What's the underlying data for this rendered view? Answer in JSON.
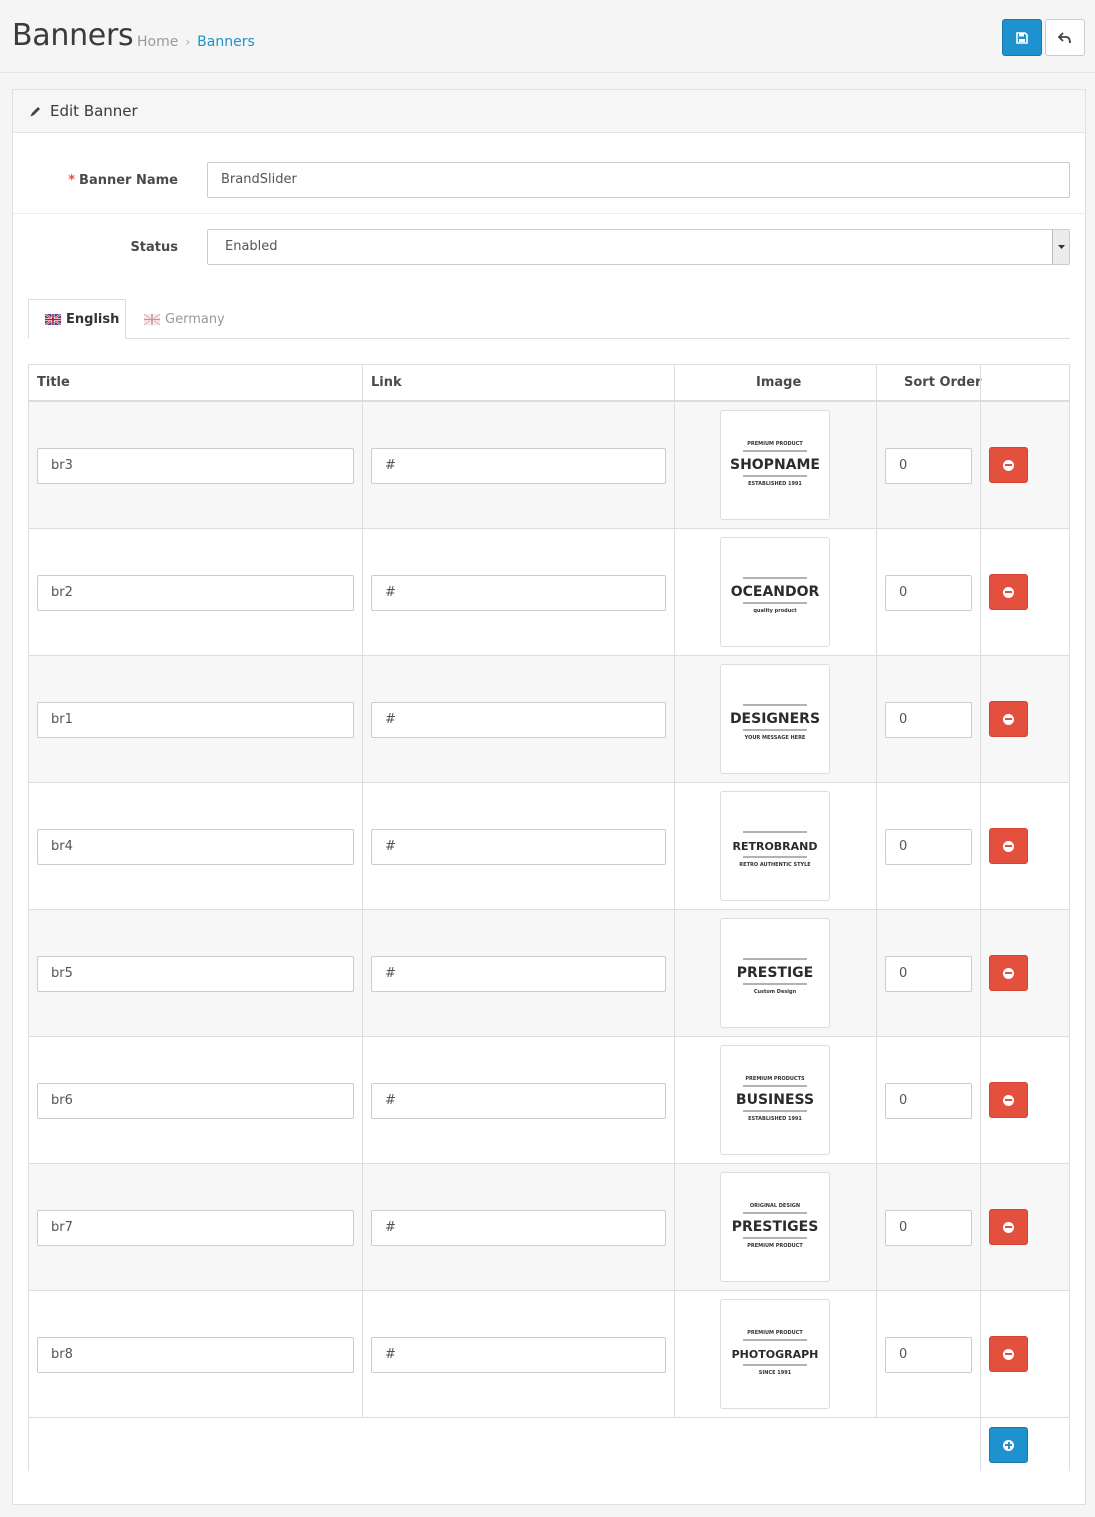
{
  "header": {
    "title": "Banners",
    "breadcrumb": [
      "Home",
      "Banners"
    ],
    "breadcrumb_sep": "›",
    "save_icon": "save-icon",
    "back_icon": "reply-icon"
  },
  "panel": {
    "title": "Edit Banner",
    "icon": "pencil-icon"
  },
  "form": {
    "banner_name_label": "Banner Name",
    "banner_name_required": "*",
    "banner_name_value": "BrandSlider",
    "status_label": "Status",
    "status_value": "Enabled"
  },
  "tabs": [
    {
      "label": "English",
      "active": true
    },
    {
      "label": "Germany",
      "active": false
    }
  ],
  "table": {
    "headers": [
      "Title",
      "Link",
      "Image",
      "Sort Order"
    ],
    "rows": [
      {
        "title": "br3",
        "link": "#",
        "image": "SHOPNAME",
        "image_sub": "ESTABLISHED 1991",
        "image_top": "PREMIUM PRODUCT",
        "sort": "0"
      },
      {
        "title": "br2",
        "link": "#",
        "image": "OCEANDOR",
        "image_sub": "quality product",
        "image_top": "",
        "sort": "0"
      },
      {
        "title": "br1",
        "link": "#",
        "image": "DESIGNERS",
        "image_sub": "YOUR MESSAGE HERE",
        "image_top": "",
        "sort": "0"
      },
      {
        "title": "br4",
        "link": "#",
        "image": "RETROBRAND",
        "image_sub": "RETRO AUTHENTIC STYLE",
        "image_top": "",
        "sort": "0"
      },
      {
        "title": "br5",
        "link": "#",
        "image": "PRESTIGE",
        "image_sub": "Custom Design",
        "image_top": "",
        "sort": "0"
      },
      {
        "title": "br6",
        "link": "#",
        "image": "BUSINESS",
        "image_sub": "ESTABLISHED 1991",
        "image_top": "PREMIUM PRODUCTS",
        "sort": "0"
      },
      {
        "title": "br7",
        "link": "#",
        "image": "PRESTIGES",
        "image_sub": "PREMIUM PRODUCT",
        "image_top": "ORIGINAL DESIGN",
        "sort": "0"
      },
      {
        "title": "br8",
        "link": "#",
        "image": "PHOTOGRAPH",
        "image_sub": "SINCE 1991",
        "image_top": "PREMIUM PRODUCT",
        "sort": "0"
      }
    ]
  },
  "colors": {
    "primary": "#1e91cf",
    "danger": "#e3503e",
    "required": "#e3503e"
  }
}
